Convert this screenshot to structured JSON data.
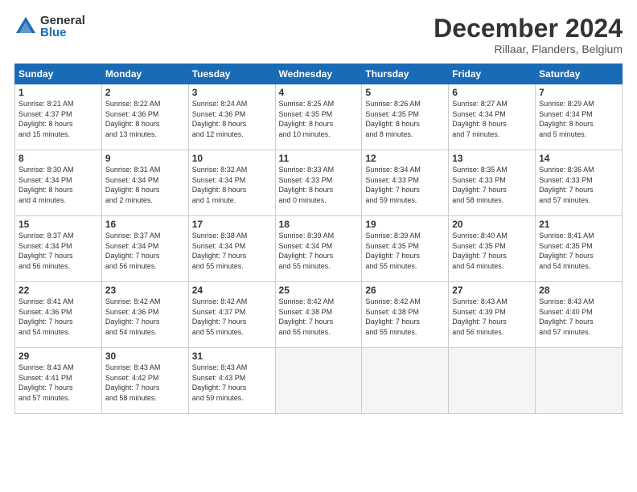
{
  "logo": {
    "general": "General",
    "blue": "Blue"
  },
  "title": "December 2024",
  "location": "Rillaar, Flanders, Belgium",
  "days_header": [
    "Sunday",
    "Monday",
    "Tuesday",
    "Wednesday",
    "Thursday",
    "Friday",
    "Saturday"
  ],
  "weeks": [
    [
      {
        "day": "1",
        "info": "Sunrise: 8:21 AM\nSunset: 4:37 PM\nDaylight: 8 hours\nand 15 minutes."
      },
      {
        "day": "2",
        "info": "Sunrise: 8:22 AM\nSunset: 4:36 PM\nDaylight: 8 hours\nand 13 minutes."
      },
      {
        "day": "3",
        "info": "Sunrise: 8:24 AM\nSunset: 4:36 PM\nDaylight: 8 hours\nand 12 minutes."
      },
      {
        "day": "4",
        "info": "Sunrise: 8:25 AM\nSunset: 4:35 PM\nDaylight: 8 hours\nand 10 minutes."
      },
      {
        "day": "5",
        "info": "Sunrise: 8:26 AM\nSunset: 4:35 PM\nDaylight: 8 hours\nand 8 minutes."
      },
      {
        "day": "6",
        "info": "Sunrise: 8:27 AM\nSunset: 4:34 PM\nDaylight: 8 hours\nand 7 minutes."
      },
      {
        "day": "7",
        "info": "Sunrise: 8:29 AM\nSunset: 4:34 PM\nDaylight: 8 hours\nand 5 minutes."
      }
    ],
    [
      {
        "day": "8",
        "info": "Sunrise: 8:30 AM\nSunset: 4:34 PM\nDaylight: 8 hours\nand 4 minutes."
      },
      {
        "day": "9",
        "info": "Sunrise: 8:31 AM\nSunset: 4:34 PM\nDaylight: 8 hours\nand 2 minutes."
      },
      {
        "day": "10",
        "info": "Sunrise: 8:32 AM\nSunset: 4:34 PM\nDaylight: 8 hours\nand 1 minute."
      },
      {
        "day": "11",
        "info": "Sunrise: 8:33 AM\nSunset: 4:33 PM\nDaylight: 8 hours\nand 0 minutes."
      },
      {
        "day": "12",
        "info": "Sunrise: 8:34 AM\nSunset: 4:33 PM\nDaylight: 7 hours\nand 59 minutes."
      },
      {
        "day": "13",
        "info": "Sunrise: 8:35 AM\nSunset: 4:33 PM\nDaylight: 7 hours\nand 58 minutes."
      },
      {
        "day": "14",
        "info": "Sunrise: 8:36 AM\nSunset: 4:33 PM\nDaylight: 7 hours\nand 57 minutes."
      }
    ],
    [
      {
        "day": "15",
        "info": "Sunrise: 8:37 AM\nSunset: 4:34 PM\nDaylight: 7 hours\nand 56 minutes."
      },
      {
        "day": "16",
        "info": "Sunrise: 8:37 AM\nSunset: 4:34 PM\nDaylight: 7 hours\nand 56 minutes."
      },
      {
        "day": "17",
        "info": "Sunrise: 8:38 AM\nSunset: 4:34 PM\nDaylight: 7 hours\nand 55 minutes."
      },
      {
        "day": "18",
        "info": "Sunrise: 8:39 AM\nSunset: 4:34 PM\nDaylight: 7 hours\nand 55 minutes."
      },
      {
        "day": "19",
        "info": "Sunrise: 8:39 AM\nSunset: 4:35 PM\nDaylight: 7 hours\nand 55 minutes."
      },
      {
        "day": "20",
        "info": "Sunrise: 8:40 AM\nSunset: 4:35 PM\nDaylight: 7 hours\nand 54 minutes."
      },
      {
        "day": "21",
        "info": "Sunrise: 8:41 AM\nSunset: 4:35 PM\nDaylight: 7 hours\nand 54 minutes."
      }
    ],
    [
      {
        "day": "22",
        "info": "Sunrise: 8:41 AM\nSunset: 4:36 PM\nDaylight: 7 hours\nand 54 minutes."
      },
      {
        "day": "23",
        "info": "Sunrise: 8:42 AM\nSunset: 4:36 PM\nDaylight: 7 hours\nand 54 minutes."
      },
      {
        "day": "24",
        "info": "Sunrise: 8:42 AM\nSunset: 4:37 PM\nDaylight: 7 hours\nand 55 minutes."
      },
      {
        "day": "25",
        "info": "Sunrise: 8:42 AM\nSunset: 4:38 PM\nDaylight: 7 hours\nand 55 minutes."
      },
      {
        "day": "26",
        "info": "Sunrise: 8:42 AM\nSunset: 4:38 PM\nDaylight: 7 hours\nand 55 minutes."
      },
      {
        "day": "27",
        "info": "Sunrise: 8:43 AM\nSunset: 4:39 PM\nDaylight: 7 hours\nand 56 minutes."
      },
      {
        "day": "28",
        "info": "Sunrise: 8:43 AM\nSunset: 4:40 PM\nDaylight: 7 hours\nand 57 minutes."
      }
    ],
    [
      {
        "day": "29",
        "info": "Sunrise: 8:43 AM\nSunset: 4:41 PM\nDaylight: 7 hours\nand 57 minutes."
      },
      {
        "day": "30",
        "info": "Sunrise: 8:43 AM\nSunset: 4:42 PM\nDaylight: 7 hours\nand 58 minutes."
      },
      {
        "day": "31",
        "info": "Sunrise: 8:43 AM\nSunset: 4:43 PM\nDaylight: 7 hours\nand 59 minutes."
      },
      {
        "day": "",
        "info": ""
      },
      {
        "day": "",
        "info": ""
      },
      {
        "day": "",
        "info": ""
      },
      {
        "day": "",
        "info": ""
      }
    ]
  ]
}
